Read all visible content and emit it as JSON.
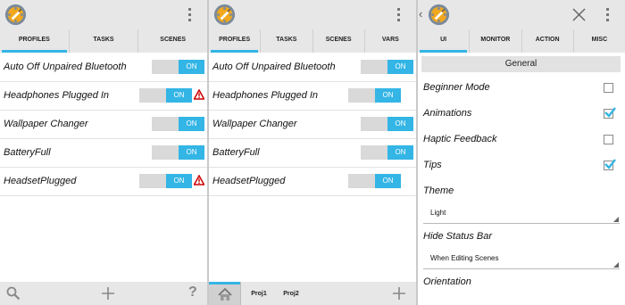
{
  "colors": {
    "accent": "#33b5e5",
    "bar": "#e7e7e7",
    "warning": "#cc0000"
  },
  "panel1": {
    "tabs": [
      {
        "label": "PROFILES",
        "active": true
      },
      {
        "label": "TASKS"
      },
      {
        "label": "SCENES"
      }
    ],
    "profiles": [
      {
        "name": "Auto Off Unpaired Bluetooth",
        "state": "ON",
        "warning": false
      },
      {
        "name": "Headphones Plugged In",
        "state": "ON",
        "warning": true
      },
      {
        "name": "Wallpaper Changer",
        "state": "ON",
        "warning": false
      },
      {
        "name": "BatteryFull",
        "state": "ON",
        "warning": false
      },
      {
        "name": "HeadsetPlugged",
        "state": "ON",
        "warning": true
      }
    ],
    "bottom_icons": [
      "search-icon",
      "plus-icon",
      "help-icon"
    ],
    "help_glyph": "?"
  },
  "panel2": {
    "tabs": [
      {
        "label": "PROFILES",
        "active": true
      },
      {
        "label": "TASKS"
      },
      {
        "label": "SCENES"
      },
      {
        "label": "VARS"
      }
    ],
    "profiles": [
      {
        "name": "Auto Off Unpaired Bluetooth",
        "state": "ON",
        "warning": false
      },
      {
        "name": "Headphones Plugged In",
        "state": "ON",
        "warning": false
      },
      {
        "name": "Wallpaper Changer",
        "state": "ON",
        "warning": false
      },
      {
        "name": "BatteryFull",
        "state": "ON",
        "warning": false
      },
      {
        "name": "HeadsetPlugged",
        "state": "ON",
        "warning": false
      }
    ],
    "projects": [
      "Proj1",
      "Proj2"
    ]
  },
  "panel3": {
    "tabs": [
      {
        "label": "UI",
        "active": true
      },
      {
        "label": "MONITOR"
      },
      {
        "label": "ACTION"
      },
      {
        "label": "MISC"
      }
    ],
    "section": "General",
    "prefs": {
      "beginner_mode": {
        "label": "Beginner Mode",
        "checked": false
      },
      "animations": {
        "label": "Animations",
        "checked": true
      },
      "haptic_feedback": {
        "label": "Haptic Feedback",
        "checked": false
      },
      "tips": {
        "label": "Tips",
        "checked": true
      },
      "theme": {
        "label": "Theme",
        "value": "Light"
      },
      "hide_status_bar": {
        "label": "Hide Status Bar",
        "value": "When Editing Scenes"
      },
      "orientation": {
        "label": "Orientation"
      }
    }
  }
}
